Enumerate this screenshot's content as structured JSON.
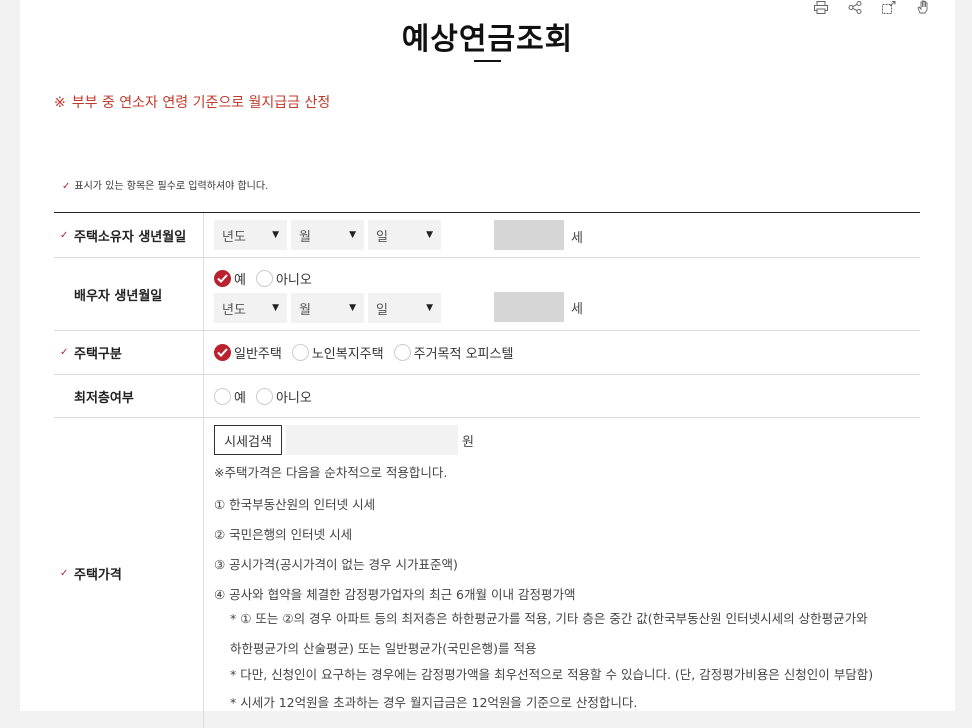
{
  "toolbar": {
    "icons": [
      "print-icon",
      "share-icon",
      "expand-icon",
      "hand-icon"
    ]
  },
  "header": {
    "title": "예상연금조회"
  },
  "notice": {
    "mark": "※",
    "text": "부부 중 연소자 연령 기준으로 월지급금 산정"
  },
  "required_note": "표시가 있는 항목은 필수로 입력하셔야 합니다.",
  "form": {
    "owner_birth": {
      "label": "주택소유자 생년월일",
      "year_placeholder": "년도",
      "month_placeholder": "월",
      "day_placeholder": "일",
      "age_unit": "세"
    },
    "spouse_birth": {
      "label": "배우자 생년월일",
      "options": [
        "예",
        "아니오"
      ],
      "selected": "예",
      "year_placeholder": "년도",
      "month_placeholder": "월",
      "day_placeholder": "일",
      "age_unit": "세"
    },
    "house_type": {
      "label": "주택구분",
      "options": [
        "일반주택",
        "노인복지주택",
        "주거목적 오피스텔"
      ],
      "selected": "일반주택"
    },
    "lowest_floor": {
      "label": "최저층여부",
      "options": [
        "예",
        "아니오"
      ],
      "selected": ""
    },
    "house_price": {
      "label": "주택가격",
      "search_button": "시세검색",
      "unit": "원",
      "lines": [
        "※주택가격은 다음을 순차적으로 적용합니다.",
        "① 한국부동산원의 인터넷 시세",
        "② 국민은행의 인터넷 시세",
        "③ 공시가격(공시가격이 없는 경우 시가표준액)",
        "④ 공사와 협약을 체결한 감정평가업자의 최근 6개월 이내 감정평가액",
        "* ① 또는 ②의 경우 아파트 등의 최저층은 하한평균가를 적용, 기타 층은 중간 값(한국부동산원 인터넷시세의 상한평균가와",
        "하한평균가의 산술평균) 또는 일반평균가(국민은행)를 적용",
        "* 다만, 신청인이 요구하는 경우에는 감정평가액을 최우선적으로 적용할 수 있습니다. (단, 감정평가비용은 신청인이 부담함)",
        "* 시세가 12억원을 초과하는 경우 월지급금은 12억원을 기준으로 산정합니다."
      ]
    }
  },
  "colors": {
    "accent": "#b8232f",
    "notice": "#c0392b"
  }
}
